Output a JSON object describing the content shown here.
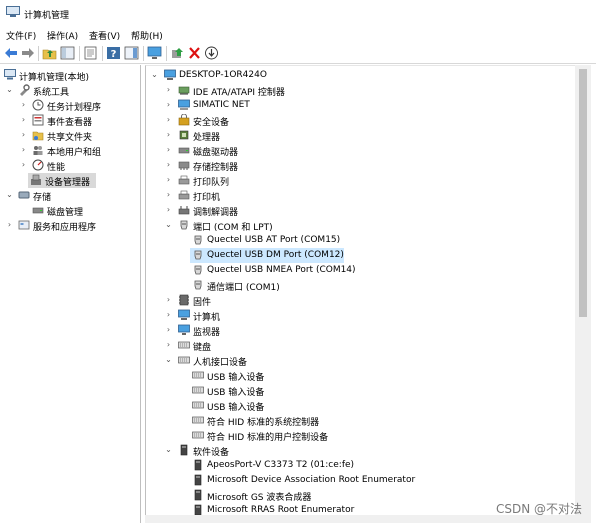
{
  "window": {
    "title": "计算机管理"
  },
  "menu": [
    "文件(F)",
    "操作(A)",
    "查看(V)",
    "帮助(H)"
  ],
  "left_tree": [
    {
      "label": "计算机管理(本地)",
      "icon": "computer-management-icon",
      "level": 0,
      "arrow": ""
    },
    {
      "label": "系统工具",
      "icon": "system-tools-icon",
      "level": 1,
      "arrow": "down"
    },
    {
      "label": "任务计划程序",
      "icon": "clock-icon",
      "level": 2,
      "arrow": "right"
    },
    {
      "label": "事件查看器",
      "icon": "event-viewer-icon",
      "level": 2,
      "arrow": "right"
    },
    {
      "label": "共享文件夹",
      "icon": "shared-folder-icon",
      "level": 2,
      "arrow": "right"
    },
    {
      "label": "本地用户和组",
      "icon": "users-icon",
      "level": 2,
      "arrow": "right"
    },
    {
      "label": "性能",
      "icon": "performance-icon",
      "level": 2,
      "arrow": "right"
    },
    {
      "label": "设备管理器",
      "icon": "device-manager-icon",
      "level": 2,
      "arrow": "",
      "selected": true
    },
    {
      "label": "存储",
      "icon": "storage-icon",
      "level": 1,
      "arrow": "down"
    },
    {
      "label": "磁盘管理",
      "icon": "disk-icon",
      "level": 2,
      "arrow": ""
    },
    {
      "label": "服务和应用程序",
      "icon": "services-icon",
      "level": 1,
      "arrow": "right"
    }
  ],
  "device_tree": [
    {
      "label": "DESKTOP-1OR424O",
      "icon": "computer-icon",
      "level": 0,
      "arrow": "down"
    },
    {
      "label": "IDE ATA/ATAPI 控制器",
      "icon": "ide-controller-icon",
      "level": 1,
      "arrow": "right"
    },
    {
      "label": "SIMATIC NET",
      "icon": "network-icon",
      "level": 1,
      "arrow": "right"
    },
    {
      "label": "安全设备",
      "icon": "security-device-icon",
      "level": 1,
      "arrow": "right"
    },
    {
      "label": "处理器",
      "icon": "processor-icon",
      "level": 1,
      "arrow": "right"
    },
    {
      "label": "磁盘驱动器",
      "icon": "disk-drive-icon",
      "level": 1,
      "arrow": "right"
    },
    {
      "label": "存储控制器",
      "icon": "storage-controller-icon",
      "level": 1,
      "arrow": "right"
    },
    {
      "label": "打印队列",
      "icon": "printer-icon",
      "level": 1,
      "arrow": "right"
    },
    {
      "label": "打印机",
      "icon": "printer-icon",
      "level": 1,
      "arrow": "right"
    },
    {
      "label": "调制解调器",
      "icon": "modem-icon",
      "level": 1,
      "arrow": "right"
    },
    {
      "label": "端口 (COM 和 LPT)",
      "icon": "port-icon",
      "level": 1,
      "arrow": "down"
    },
    {
      "label": "Quectel USB AT Port (COM15)",
      "icon": "port-icon",
      "level": 2,
      "arrow": ""
    },
    {
      "label": "Quectel USB DM Port (COM12)",
      "icon": "port-icon",
      "level": 2,
      "arrow": "",
      "selected": true
    },
    {
      "label": "Quectel USB NMEA Port (COM14)",
      "icon": "port-icon",
      "level": 2,
      "arrow": ""
    },
    {
      "label": "通信端口 (COM1)",
      "icon": "port-icon",
      "level": 2,
      "arrow": ""
    },
    {
      "label": "固件",
      "icon": "firmware-icon",
      "level": 1,
      "arrow": "right"
    },
    {
      "label": "计算机",
      "icon": "computer-icon",
      "level": 1,
      "arrow": "right"
    },
    {
      "label": "监视器",
      "icon": "monitor-icon",
      "level": 1,
      "arrow": "right"
    },
    {
      "label": "键盘",
      "icon": "keyboard-icon",
      "level": 1,
      "arrow": "right"
    },
    {
      "label": "人机接口设备",
      "icon": "hid-icon",
      "level": 1,
      "arrow": "down"
    },
    {
      "label": "USB 输入设备",
      "icon": "hid-icon",
      "level": 2,
      "arrow": ""
    },
    {
      "label": "USB 输入设备",
      "icon": "hid-icon",
      "level": 2,
      "arrow": ""
    },
    {
      "label": "USB 输入设备",
      "icon": "hid-icon",
      "level": 2,
      "arrow": ""
    },
    {
      "label": "符合 HID 标准的系统控制器",
      "icon": "hid-icon",
      "level": 2,
      "arrow": ""
    },
    {
      "label": "符合 HID 标准的用户控制设备",
      "icon": "hid-icon",
      "level": 2,
      "arrow": ""
    },
    {
      "label": "软件设备",
      "icon": "software-device-icon",
      "level": 1,
      "arrow": "down"
    },
    {
      "label": "ApeosPort-V C3373 T2 (01:ce:fe)",
      "icon": "software-device-icon",
      "level": 2,
      "arrow": ""
    },
    {
      "label": "Microsoft Device Association Root Enumerator",
      "icon": "software-device-icon",
      "level": 2,
      "arrow": ""
    },
    {
      "label": "Microsoft GS 波表合成器",
      "icon": "software-device-icon",
      "level": 2,
      "arrow": ""
    },
    {
      "label": "Microsoft RRAS Root Enumerator",
      "icon": "software-device-icon",
      "level": 2,
      "arrow": ""
    }
  ],
  "watermark": "CSDN @不对法"
}
